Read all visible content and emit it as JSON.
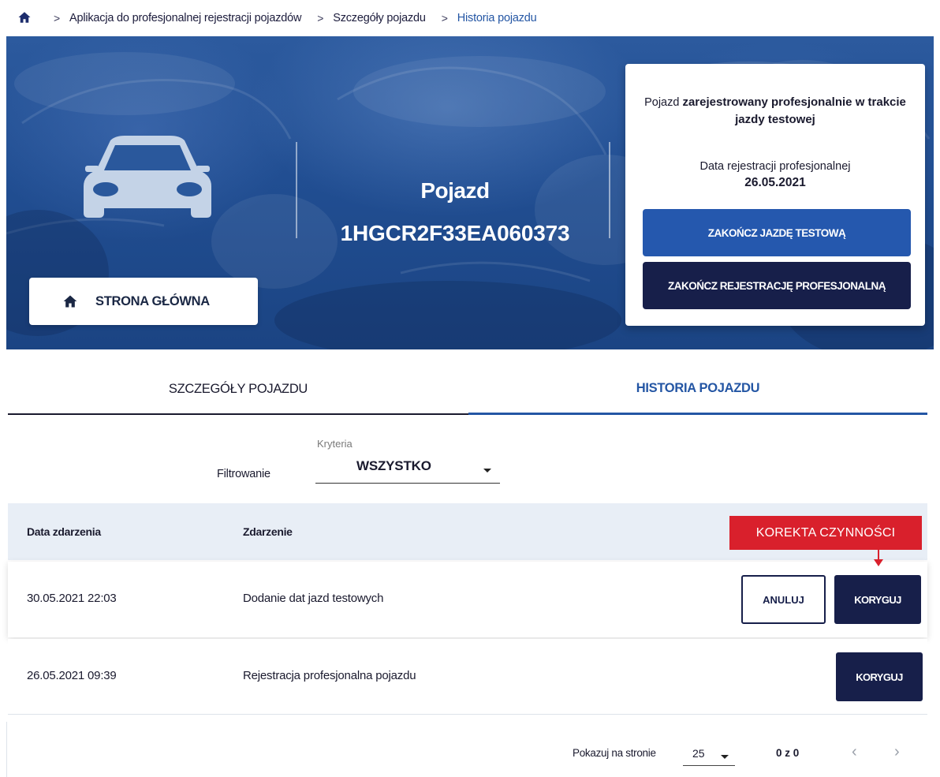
{
  "breadcrumb": {
    "items": [
      "Aplikacja do profesjonalnej rejestracji pojazdów",
      "Szczegóły pojazdu",
      "Historia pojazdu"
    ]
  },
  "hero": {
    "home_button_label": "STRONA GŁÓWNA",
    "vehicle_label": "Pojazd",
    "vin": "1HGCR2F33EA060373"
  },
  "status_card": {
    "status_prefix": "Pojazd ",
    "status_bold": "zarejestrowany profesjonalnie w trakcie jazdy testowej",
    "registration_label": "Data rejestracji profesjonalnej",
    "registration_date": "26.05.2021",
    "end_test_drive_button": "ZAKOŃCZ JAZDĘ TESTOWĄ",
    "end_registration_button": "ZAKOŃCZ REJESTRACJĘ PROFESJONALNĄ"
  },
  "tabs": [
    {
      "label": "SZCZEGÓŁY POJAZDU",
      "active": false
    },
    {
      "label": "HISTORIA POJAZDU",
      "active": true
    }
  ],
  "filter": {
    "label": "Filtrowanie",
    "criteria_label": "Kryteria",
    "selected": "WSZYSTKO"
  },
  "table": {
    "headers": [
      "Data zdarzenia",
      "Zdarzenie"
    ],
    "rows": [
      {
        "date": "30.05.2021 22:03",
        "event": "Dodanie dat jazd testowych",
        "cancel_label": "ANULUJ",
        "correct_label": "KORYGUJ"
      },
      {
        "date": "26.05.2021 09:39",
        "event": "Rejestracja profesjonalna pojazdu",
        "correct_label": "KORYGUJ"
      }
    ]
  },
  "callout": {
    "text": "KOREKTA CZYNNOŚCI",
    "color": "#d9202c"
  },
  "pagination": {
    "per_page_label": "Pokazuj na stronie",
    "per_page_value": "25",
    "range": "0 z 0"
  },
  "colors": {
    "brand_blue": "#2558ae",
    "navy": "#171f4a",
    "active_tab": "#2456a4",
    "header_row_bg": "#e8eef6"
  }
}
